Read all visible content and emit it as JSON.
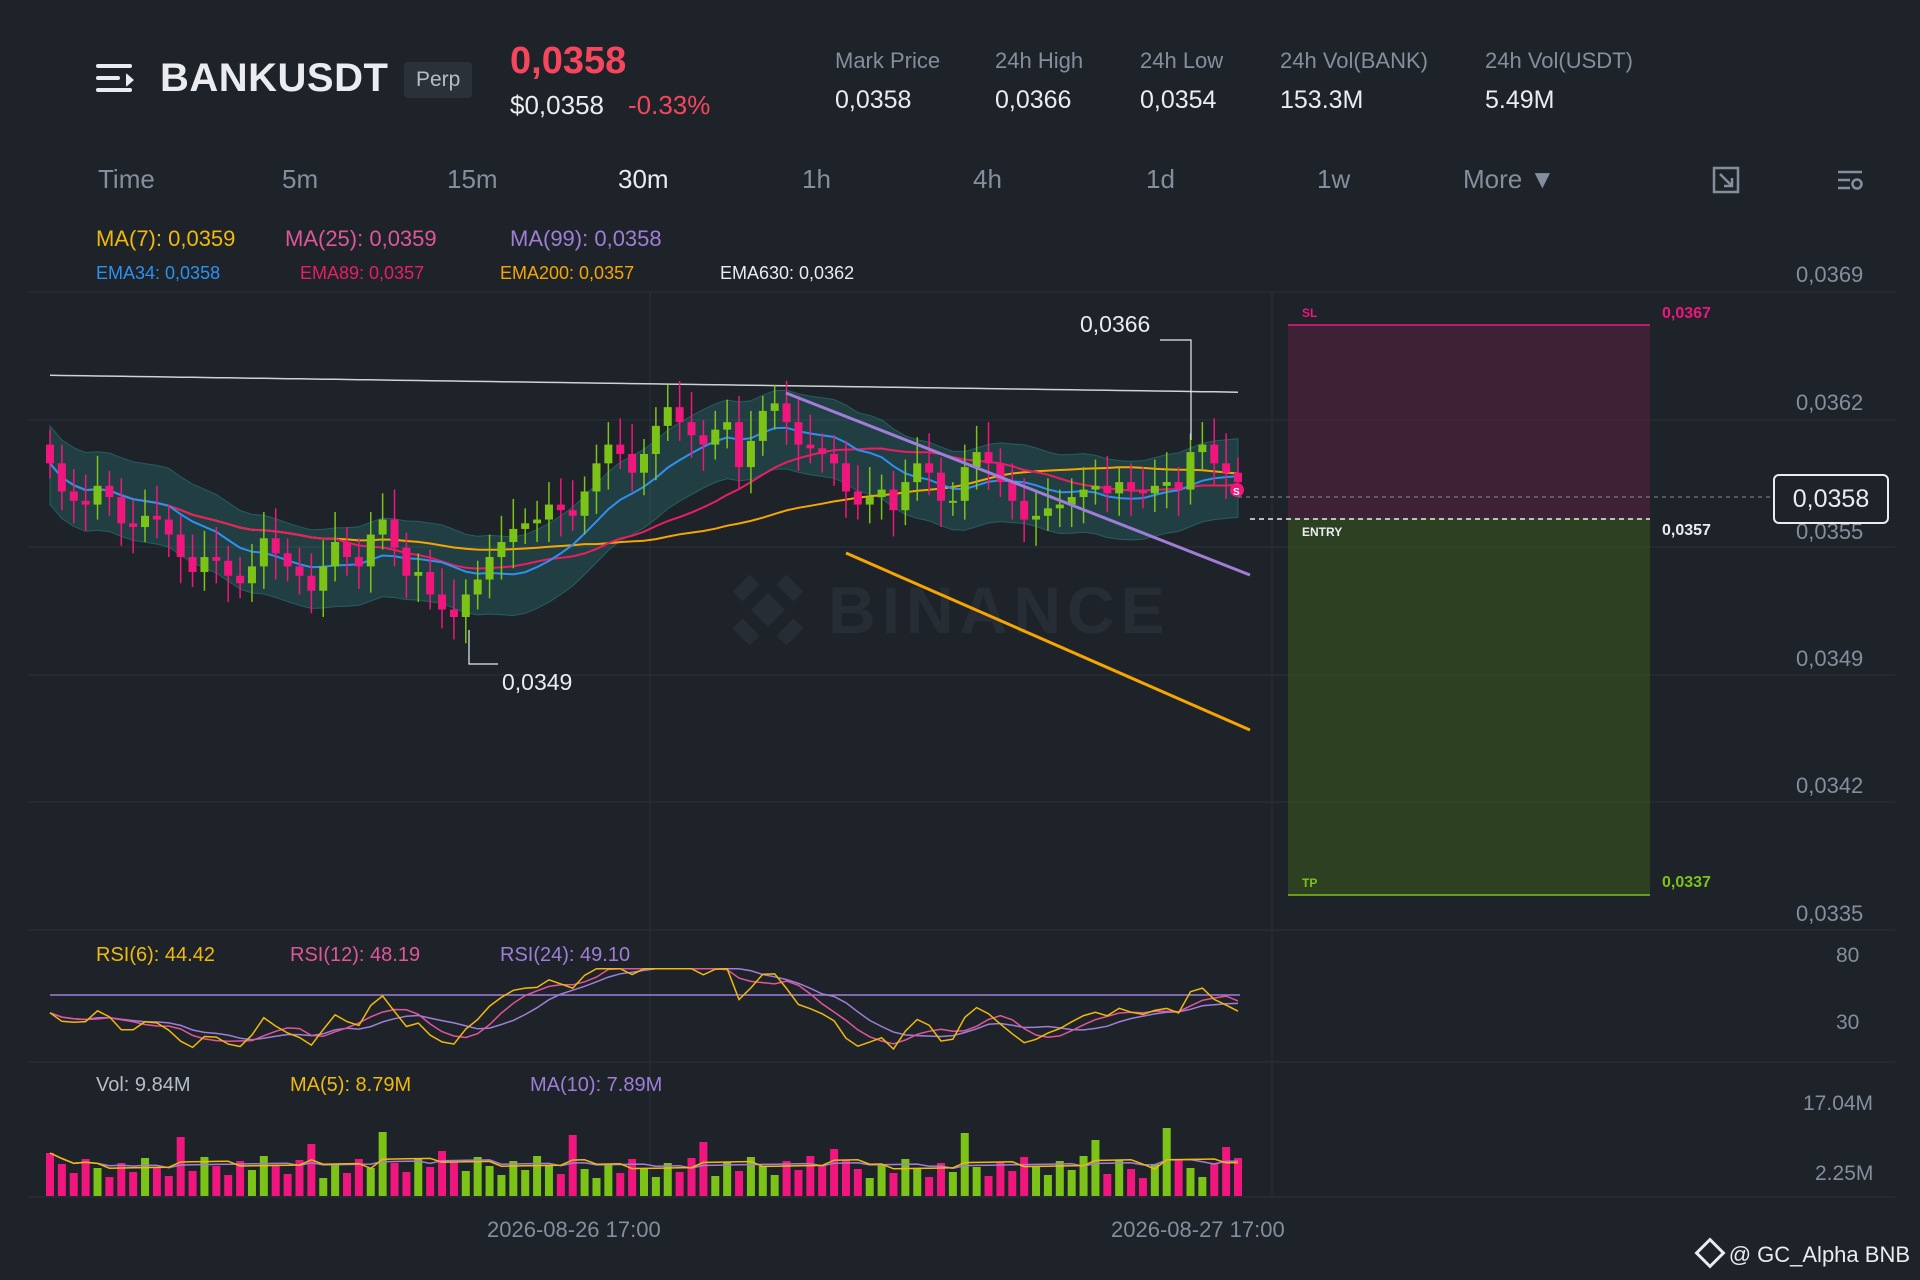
{
  "header": {
    "symbol": "BANKUSDT",
    "contract_type": "Perp",
    "last_price": "0,0358",
    "usd_price": "$0,0358",
    "change_pct": "-0.33%",
    "stats": [
      {
        "label": "Mark Price",
        "value": "0,0358"
      },
      {
        "label": "24h High",
        "value": "0,0366"
      },
      {
        "label": "24h Low",
        "value": "0,0354"
      },
      {
        "label": "24h Vol(BANK)",
        "value": "153.3M"
      },
      {
        "label": "24h Vol(USDT)",
        "value": "5.49M"
      }
    ]
  },
  "timeframes": [
    "Time",
    "5m",
    "15m",
    "30m",
    "1h",
    "4h",
    "1d",
    "1w"
  ],
  "active_timeframe": "30m",
  "more_label": "More ▼",
  "indicators": {
    "ma7": "MA(7): 0,0359",
    "ma25": "MA(25): 0,0359",
    "ma99": "MA(99): 0,0358",
    "ema34": "EMA34: 0,0358",
    "ema89": "EMA89: 0,0357",
    "ema200": "EMA200: 0,0357",
    "ema630": "EMA630: 0,0362"
  },
  "price_axis": [
    "0,0369",
    "0,0362",
    "0,0355",
    "0,0349",
    "0,0342",
    "0,0335"
  ],
  "current_price_tag": "0,0358",
  "annotations": {
    "high_marker": "0,0366",
    "low_marker": "0,0349",
    "sl_label": "SL",
    "sl_value": "0,0367",
    "entry_label": "ENTRY",
    "entry_value": "0,0357",
    "tp_label": "TP",
    "tp_value": "0,0337",
    "short_marker": "S"
  },
  "watermark": "BINANCE",
  "rsi": {
    "rsi6": "RSI(6): 44.42",
    "rsi12": "RSI(12): 48.19",
    "rsi24": "RSI(24): 49.10",
    "axis": [
      "80",
      "30"
    ]
  },
  "volume": {
    "vol": "Vol: 9.84M",
    "ma5": "MA(5): 8.79M",
    "ma10": "MA(10): 7.89M",
    "axis": [
      "17.04M",
      "2.25M"
    ]
  },
  "time_axis": [
    "2026-08-26 17:00",
    "2026-08-27 17:00"
  ],
  "credit": "@ GC_Alpha BNB",
  "colors": {
    "bg": "#1e2329",
    "up": "#7cc318",
    "down": "#f0167d",
    "ma7": "#f0b90b",
    "ma25": "#e0569a",
    "ma99": "#9f7ed8",
    "ema34": "#2e90f0",
    "ema89": "#e91e63",
    "ema200": "#f7a600",
    "ema630": "#cfd3d8"
  }
}
